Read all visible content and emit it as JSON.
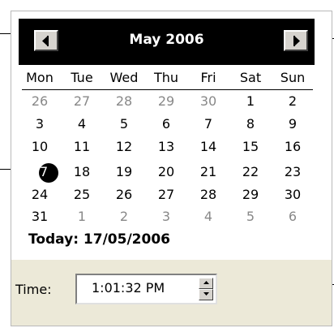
{
  "calendar": {
    "month_title": "May 2006",
    "weekdays": [
      "Mon",
      "Tue",
      "Wed",
      "Thu",
      "Fri",
      "Sat",
      "Sun"
    ],
    "weeks": [
      [
        "26",
        "27",
        "28",
        "29",
        "30",
        "1",
        "2"
      ],
      [
        "3",
        "4",
        "5",
        "6",
        "7",
        "8",
        "9"
      ],
      [
        "10",
        "11",
        "12",
        "13",
        "14",
        "15",
        "16"
      ],
      [
        "17",
        "18",
        "19",
        "20",
        "21",
        "22",
        "23"
      ],
      [
        "24",
        "25",
        "26",
        "27",
        "28",
        "29",
        "30"
      ],
      [
        "31",
        "1",
        "2",
        "3",
        "4",
        "5",
        "6"
      ]
    ],
    "selected_day": "17",
    "today_text": "Today: 17/05/2006"
  },
  "time": {
    "label": "Time:",
    "value": "1:01:32 PM"
  },
  "colors": {
    "month_bar": "#000000",
    "panel": "#ece9d8",
    "other_month_day": "#888888"
  },
  "icons": {
    "prev": "left-arrow-icon",
    "next": "right-arrow-icon",
    "spin_up": "spin-up-icon",
    "spin_down": "spin-down-icon"
  }
}
